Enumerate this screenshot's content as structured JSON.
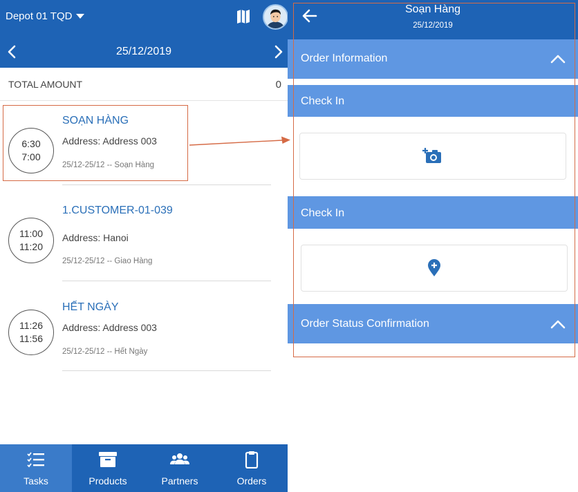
{
  "left": {
    "depot_label": "Depot 01 TQD",
    "date": "25/12/2019",
    "total_label": "TOTAL AMOUNT",
    "total_value": "0",
    "tasks": [
      {
        "start": "6:30",
        "end": "7:00",
        "title": "SOẠN HÀNG",
        "address": "Address: Address 003",
        "meta": "25/12-25/12 -- Soạn Hàng"
      },
      {
        "start": "11:00",
        "end": "11:20",
        "title": "1.CUSTOMER-01-039",
        "address": "Address: Hanoi",
        "meta": "25/12-25/12 -- Giao Hàng"
      },
      {
        "start": "11:26",
        "end": "11:56",
        "title": "HẾT NGÀY",
        "address": "Address: Address 003",
        "meta": "25/12-25/12 -- Hết Ngày"
      }
    ],
    "tabs": [
      {
        "label": "Tasks",
        "icon": "tasks-icon"
      },
      {
        "label": "Products",
        "icon": "archive-box-icon"
      },
      {
        "label": "Partners",
        "icon": "people-icon"
      },
      {
        "label": "Orders",
        "icon": "clipboard-icon"
      }
    ]
  },
  "right": {
    "title": "Soạn Hàng",
    "date": "25/12/2019",
    "sections": {
      "order_information": "Order Information",
      "check_in_photo": "Check In",
      "check_in_location": "Check In",
      "order_status": "Order Status Confirmation"
    }
  },
  "colors": {
    "primary": "#1e63b5",
    "section": "#5f97e2",
    "accent_link": "#2a6fb8",
    "highlight": "#d56a45"
  }
}
